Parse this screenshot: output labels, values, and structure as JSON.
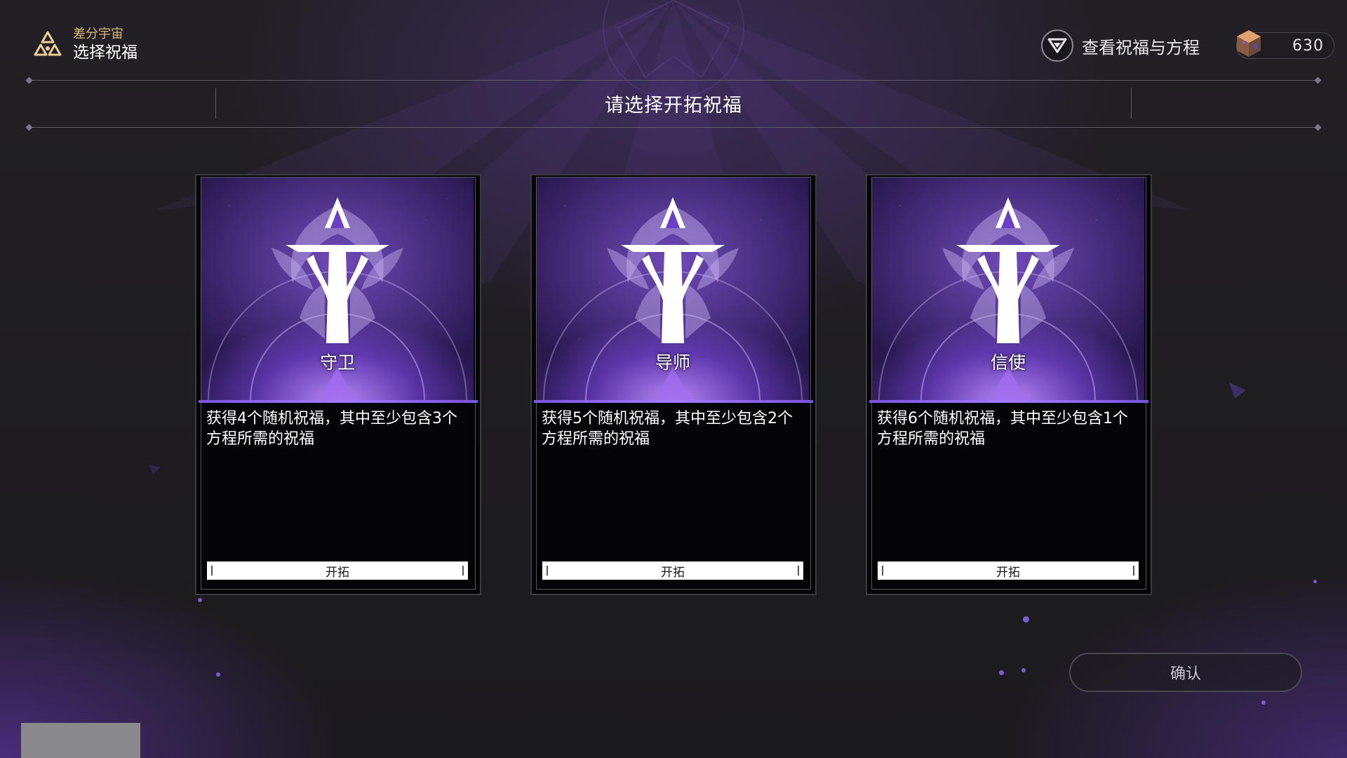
{
  "header": {
    "mode_label": "差分宇宙",
    "screen_title": "选择祝福",
    "view_button_label": "查看祝福与方程",
    "currency_amount": "630"
  },
  "prompt_title": "请选择开拓祝福",
  "cards": [
    {
      "name": "守卫",
      "description": "获得4个随机祝福，其中至少包含3个方程所需的祝福",
      "path_tag": "开拓"
    },
    {
      "name": "导师",
      "description": "获得5个随机祝福，其中至少包含2个方程所需的祝福",
      "path_tag": "开拓"
    },
    {
      "name": "信使",
      "description": "获得6个随机祝福，其中至少包含1个方程所需的祝福",
      "path_tag": "开拓"
    }
  ],
  "confirm_label": "确认",
  "colors": {
    "accent_purple": "#a27cff",
    "mode_gold": "#d9b97a"
  }
}
